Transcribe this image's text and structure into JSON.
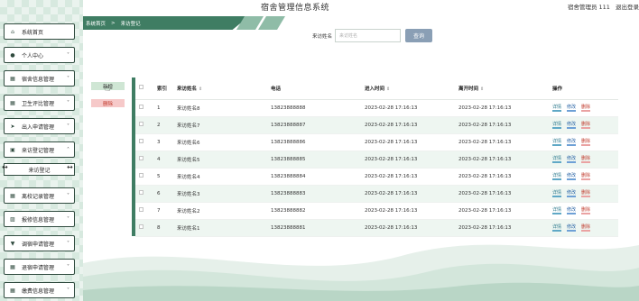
{
  "header": {
    "title": "宿舍管理信息系统",
    "user_text": "宿舍管理员 111",
    "logout": "退出登录"
  },
  "sidebar": {
    "items": [
      {
        "label": "系统首页",
        "icon": "home-icon",
        "glyph": "⌂"
      },
      {
        "label": "个人中心",
        "icon": "person-icon",
        "glyph": "●"
      },
      {
        "label": "宿舍信息管理",
        "icon": "grid-icon",
        "glyph": "▦"
      },
      {
        "label": "卫生评比管理",
        "icon": "grid-icon",
        "glyph": "▦"
      },
      {
        "label": "出入申请管理",
        "icon": "send-icon",
        "glyph": "➤"
      },
      {
        "label": "来访登记管理",
        "icon": "inbox-icon",
        "glyph": "▣"
      },
      {
        "label": "离校记录管理",
        "icon": "grid-icon",
        "glyph": "▦"
      },
      {
        "label": "报修信息管理",
        "icon": "edit-icon",
        "glyph": "▨"
      },
      {
        "label": "调宿申请管理",
        "icon": "trophy-icon",
        "glyph": "▼"
      },
      {
        "label": "退宿申请管理",
        "icon": "grid-icon",
        "glyph": "▦"
      },
      {
        "label": "缴费信息管理",
        "icon": "grid-icon",
        "glyph": "▦"
      }
    ],
    "submenu": "来访登记"
  },
  "breadcrumb": {
    "home": "系统首页",
    "separator": ">",
    "current": "来访登记"
  },
  "search": {
    "label": "来访姓名",
    "placeholder": "来访姓名",
    "button": "查询"
  },
  "actions": {
    "add": "新增",
    "delete": "删除"
  },
  "table": {
    "headers": {
      "index": "索引",
      "name": "来访姓名",
      "phone": "电话",
      "enter": "进入时间",
      "leave": "离开时间",
      "ops": "操作"
    },
    "sort_glyph": "⇕",
    "op_labels": {
      "detail": "详情",
      "edit": "修改",
      "delete": "删除"
    },
    "rows": [
      {
        "index": "1",
        "name": "来访姓名8",
        "phone": "13823888888",
        "enter": "2023-02-28 17:16:13",
        "leave": "2023-02-28 17:16:13"
      },
      {
        "index": "2",
        "name": "来访姓名7",
        "phone": "13823888887",
        "enter": "2023-02-28 17:16:13",
        "leave": "2023-02-28 17:16:13"
      },
      {
        "index": "3",
        "name": "来访姓名6",
        "phone": "13823888886",
        "enter": "2023-02-28 17:16:13",
        "leave": "2023-02-28 17:16:13"
      },
      {
        "index": "4",
        "name": "来访姓名5",
        "phone": "13823888885",
        "enter": "2023-02-28 17:16:13",
        "leave": "2023-02-28 17:16:13"
      },
      {
        "index": "5",
        "name": "来访姓名4",
        "phone": "13823888884",
        "enter": "2023-02-28 17:16:13",
        "leave": "2023-02-28 17:16:13"
      },
      {
        "index": "6",
        "name": "来访姓名3",
        "phone": "13823888883",
        "enter": "2023-02-28 17:16:13",
        "leave": "2023-02-28 17:16:13"
      },
      {
        "index": "7",
        "name": "来访姓名2",
        "phone": "13823888882",
        "enter": "2023-02-28 17:16:13",
        "leave": "2023-02-28 17:16:13"
      },
      {
        "index": "8",
        "name": "来访姓名1",
        "phone": "13823888881",
        "enter": "2023-02-28 17:16:13",
        "leave": "2023-02-28 17:16:13"
      }
    ]
  },
  "colors": {
    "primary": "#3f7d63",
    "light_green": "#cfe6d4",
    "search_btn": "#8a9fb5"
  }
}
